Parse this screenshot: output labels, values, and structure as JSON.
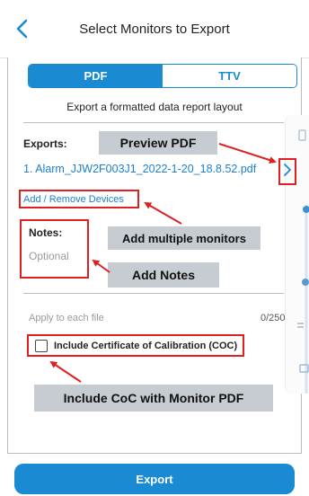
{
  "header": {
    "title": "Select Monitors to Export"
  },
  "tabs": [
    {
      "label": "PDF"
    },
    {
      "label": "TTV"
    }
  ],
  "subtitle": "Export a formatted data report layout",
  "exports": {
    "label": "Exports:",
    "file": "1. Alarm_JJW2F003J1_2022-1-20_18.8.52.pdf"
  },
  "add_remove": "Add / Remove Devices",
  "notes": {
    "label": "Notes:",
    "placeholder": "Optional"
  },
  "apply": {
    "label": "Apply to each file",
    "counter": "0/250"
  },
  "coc": {
    "label": "Include Certificate of Calibration (COC)"
  },
  "callouts": {
    "preview": "Preview PDF",
    "multiple": "Add multiple monitors",
    "notes": "Add Notes",
    "coc": "Include CoC with Monitor PDF"
  },
  "export_button": "Export",
  "colors": {
    "accent": "#1a8ad2",
    "link": "#1a7fd0",
    "annotation": "#e02020",
    "callout_bg": "#c7ccd3"
  },
  "icons": [
    "back-chevron-icon",
    "chevron-right-icon",
    "checkbox-icon",
    "arrow-icon"
  ]
}
